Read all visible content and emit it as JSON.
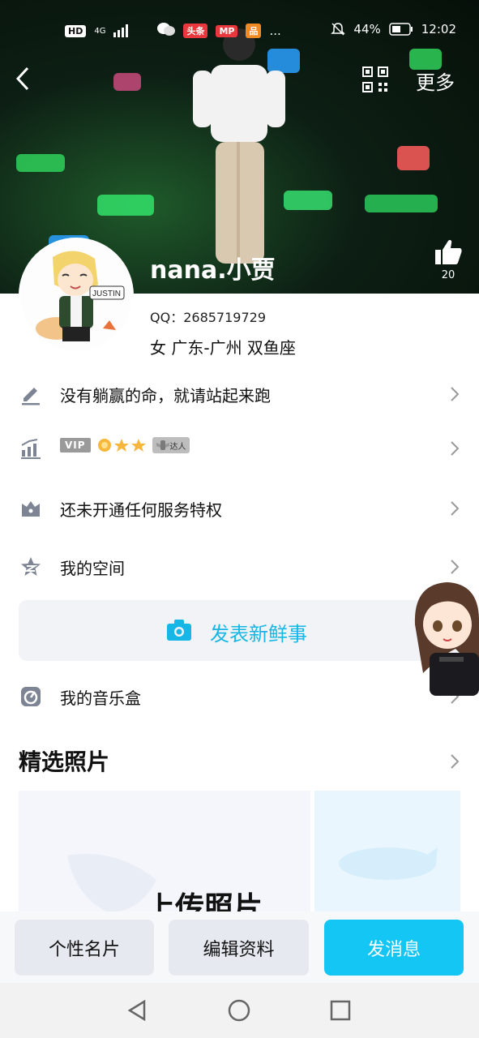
{
  "status_bar": {
    "network_labels": [
      "HD",
      "4G"
    ],
    "app_badges": [
      "头条",
      "MP",
      "..."
    ],
    "battery_percent": "44%",
    "time": "12:02"
  },
  "header": {
    "more_label": "更多",
    "like_count": "20"
  },
  "profile": {
    "nickname": "nana.小贾",
    "qq_label": "QQ：",
    "qq_number": "2685719729",
    "info": "女 广东-广州 双鱼座",
    "avatar_text": "JUSTIN"
  },
  "rows": {
    "signature": "没有躺赢的命，就请站起来跑",
    "vip_badge": "VIP",
    "vip_title": "达人",
    "service": "还未开通任何服务特权",
    "space": "我的空间",
    "music": "我的音乐盒"
  },
  "post": {
    "label": "发表新鲜事"
  },
  "photos": {
    "section_title": "精选照片",
    "upload_label": "上传照片"
  },
  "bottom_buttons": {
    "card": "个性名片",
    "edit": "编辑资料",
    "message": "发消息"
  },
  "colors": {
    "accent": "#14c6f4",
    "post_text": "#16b6e6",
    "icon_gray": "#7d8493"
  }
}
